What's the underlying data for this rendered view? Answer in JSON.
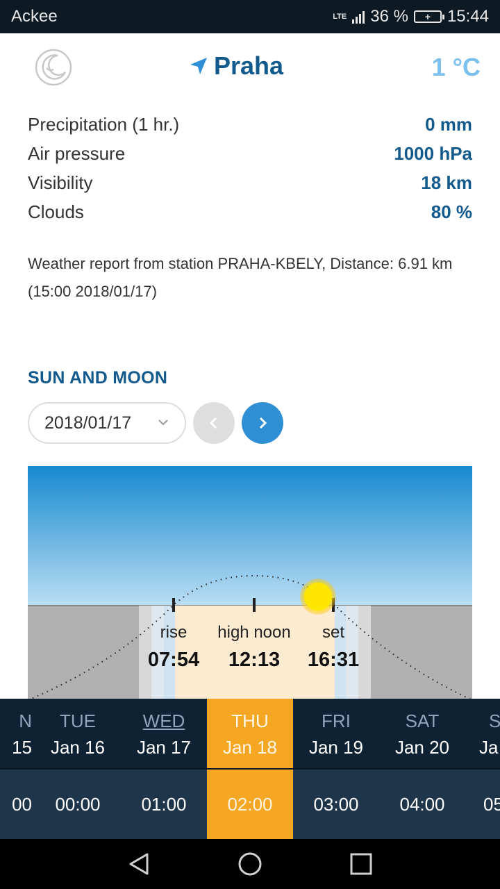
{
  "status_bar": {
    "app_name": "Ackee",
    "network": "LTE",
    "battery_text": "36 %",
    "time": "15:44"
  },
  "header": {
    "city": "Praha",
    "temperature": "1 °C",
    "icons": {
      "left": "moon-icon",
      "location": "location-arrow-icon"
    }
  },
  "stats": [
    {
      "label": "Precipitation (1 hr.)",
      "value": "0 mm"
    },
    {
      "label": "Air pressure",
      "value": "1000 hPa"
    },
    {
      "label": "Visibility",
      "value": "18 km"
    },
    {
      "label": "Clouds",
      "value": "80 %"
    }
  ],
  "report": "Weather report from station PRAHA-KBELY, Distance: 6.91 km (15:00 2018/01/17)",
  "sun_moon": {
    "title": "SUN AND MOON",
    "date": "2018/01/17",
    "rise_label": "rise",
    "rise_time": "07:54",
    "noon_label": "high noon",
    "noon_time": "12:13",
    "set_label": "set",
    "set_time": "16:31"
  },
  "days": [
    {
      "dow": "N",
      "date": "15"
    },
    {
      "dow": "TUE",
      "date": "Jan 16"
    },
    {
      "dow": "WED",
      "date": "Jan 17"
    },
    {
      "dow": "THU",
      "date": "Jan 18"
    },
    {
      "dow": "FRI",
      "date": "Jan 19"
    },
    {
      "dow": "SAT",
      "date": "Jan 20"
    },
    {
      "dow": "S",
      "date": "Ja"
    }
  ],
  "hours": [
    "00",
    "00:00",
    "01:00",
    "02:00",
    "03:00",
    "04:00",
    "05"
  ],
  "colors": {
    "accent_blue": "#135a8c",
    "active_day": "#f5a623",
    "temp": "#7cc0ee"
  }
}
